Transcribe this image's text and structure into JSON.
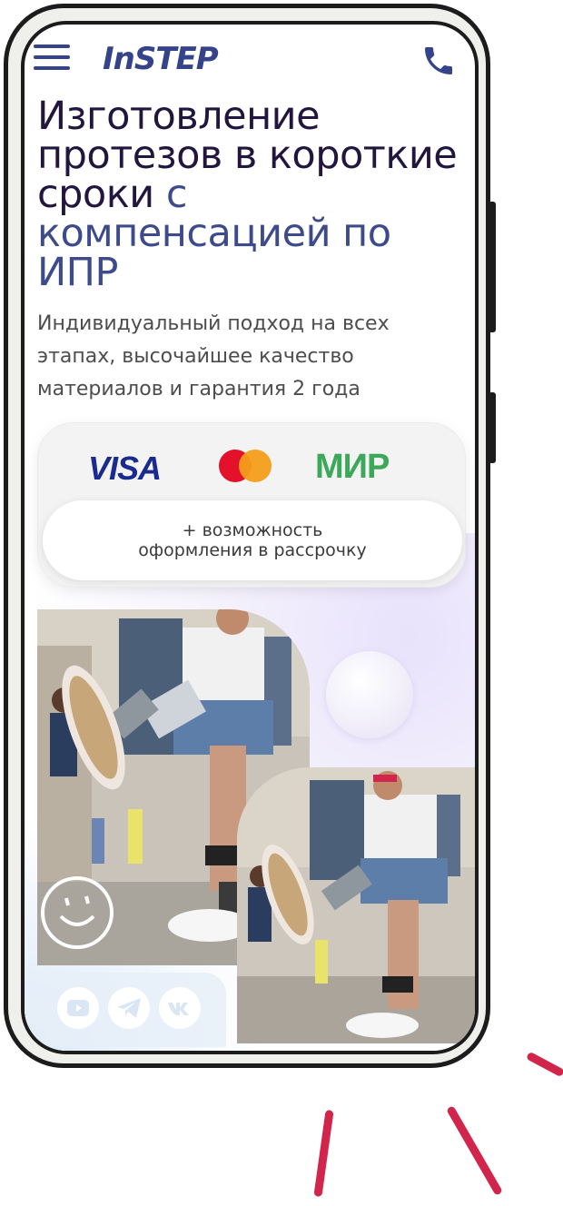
{
  "header": {
    "logo_text": "InSTEP",
    "menu_icon": "hamburger-menu-icon",
    "phone_icon": "phone-icon"
  },
  "hero": {
    "title_main": "Изготовление протезов в короткие сроки ",
    "title_accent": "с компенсацией по ИПР",
    "subtitle": "Индивидуальный подход на всех этапах, высочайшее качество материалов и гарантия 2 года"
  },
  "payment": {
    "visa_label": "VISA",
    "mir_label": "МИР",
    "mastercard_icon": "mastercard-icon",
    "installment_line1": "+ возможность",
    "installment_line2": "оформления в рассрочку"
  },
  "social": {
    "items": [
      "youtube-icon",
      "telegram-icon",
      "vk-icon"
    ]
  },
  "colors": {
    "brand": "#34438a",
    "headline": "#22163e",
    "accent_red": "#d1254c"
  }
}
